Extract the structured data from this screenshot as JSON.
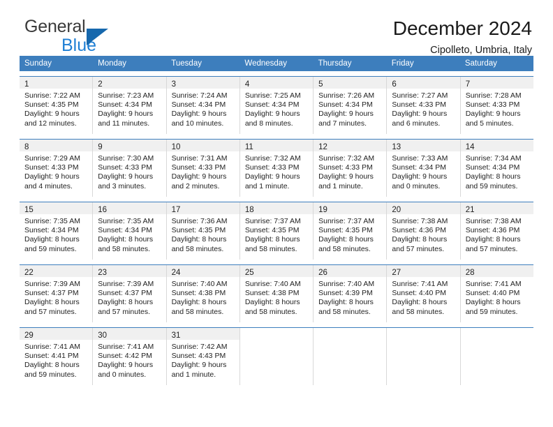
{
  "brand": {
    "line1": "General",
    "line2": "Blue",
    "triangle_color": "#1668ad",
    "blue_color": "#1f7fd4"
  },
  "header": {
    "title": "December 2024",
    "location": "Cipolleto, Umbria, Italy"
  },
  "theme": {
    "header_blue": "#3d7ebd",
    "daynum_band": "#f0f0f0",
    "grid_line": "#d8d8d8"
  },
  "weekdays": [
    "Sunday",
    "Monday",
    "Tuesday",
    "Wednesday",
    "Thursday",
    "Friday",
    "Saturday"
  ],
  "weeks": [
    [
      {
        "day": "1",
        "sunrise": "Sunrise: 7:22 AM",
        "sunset": "Sunset: 4:35 PM",
        "daylight1": "Daylight: 9 hours",
        "daylight2": "and 12 minutes."
      },
      {
        "day": "2",
        "sunrise": "Sunrise: 7:23 AM",
        "sunset": "Sunset: 4:34 PM",
        "daylight1": "Daylight: 9 hours",
        "daylight2": "and 11 minutes."
      },
      {
        "day": "3",
        "sunrise": "Sunrise: 7:24 AM",
        "sunset": "Sunset: 4:34 PM",
        "daylight1": "Daylight: 9 hours",
        "daylight2": "and 10 minutes."
      },
      {
        "day": "4",
        "sunrise": "Sunrise: 7:25 AM",
        "sunset": "Sunset: 4:34 PM",
        "daylight1": "Daylight: 9 hours",
        "daylight2": "and 8 minutes."
      },
      {
        "day": "5",
        "sunrise": "Sunrise: 7:26 AM",
        "sunset": "Sunset: 4:34 PM",
        "daylight1": "Daylight: 9 hours",
        "daylight2": "and 7 minutes."
      },
      {
        "day": "6",
        "sunrise": "Sunrise: 7:27 AM",
        "sunset": "Sunset: 4:33 PM",
        "daylight1": "Daylight: 9 hours",
        "daylight2": "and 6 minutes."
      },
      {
        "day": "7",
        "sunrise": "Sunrise: 7:28 AM",
        "sunset": "Sunset: 4:33 PM",
        "daylight1": "Daylight: 9 hours",
        "daylight2": "and 5 minutes."
      }
    ],
    [
      {
        "day": "8",
        "sunrise": "Sunrise: 7:29 AM",
        "sunset": "Sunset: 4:33 PM",
        "daylight1": "Daylight: 9 hours",
        "daylight2": "and 4 minutes."
      },
      {
        "day": "9",
        "sunrise": "Sunrise: 7:30 AM",
        "sunset": "Sunset: 4:33 PM",
        "daylight1": "Daylight: 9 hours",
        "daylight2": "and 3 minutes."
      },
      {
        "day": "10",
        "sunrise": "Sunrise: 7:31 AM",
        "sunset": "Sunset: 4:33 PM",
        "daylight1": "Daylight: 9 hours",
        "daylight2": "and 2 minutes."
      },
      {
        "day": "11",
        "sunrise": "Sunrise: 7:32 AM",
        "sunset": "Sunset: 4:33 PM",
        "daylight1": "Daylight: 9 hours",
        "daylight2": "and 1 minute."
      },
      {
        "day": "12",
        "sunrise": "Sunrise: 7:32 AM",
        "sunset": "Sunset: 4:33 PM",
        "daylight1": "Daylight: 9 hours",
        "daylight2": "and 1 minute."
      },
      {
        "day": "13",
        "sunrise": "Sunrise: 7:33 AM",
        "sunset": "Sunset: 4:34 PM",
        "daylight1": "Daylight: 9 hours",
        "daylight2": "and 0 minutes."
      },
      {
        "day": "14",
        "sunrise": "Sunrise: 7:34 AM",
        "sunset": "Sunset: 4:34 PM",
        "daylight1": "Daylight: 8 hours",
        "daylight2": "and 59 minutes."
      }
    ],
    [
      {
        "day": "15",
        "sunrise": "Sunrise: 7:35 AM",
        "sunset": "Sunset: 4:34 PM",
        "daylight1": "Daylight: 8 hours",
        "daylight2": "and 59 minutes."
      },
      {
        "day": "16",
        "sunrise": "Sunrise: 7:35 AM",
        "sunset": "Sunset: 4:34 PM",
        "daylight1": "Daylight: 8 hours",
        "daylight2": "and 58 minutes."
      },
      {
        "day": "17",
        "sunrise": "Sunrise: 7:36 AM",
        "sunset": "Sunset: 4:35 PM",
        "daylight1": "Daylight: 8 hours",
        "daylight2": "and 58 minutes."
      },
      {
        "day": "18",
        "sunrise": "Sunrise: 7:37 AM",
        "sunset": "Sunset: 4:35 PM",
        "daylight1": "Daylight: 8 hours",
        "daylight2": "and 58 minutes."
      },
      {
        "day": "19",
        "sunrise": "Sunrise: 7:37 AM",
        "sunset": "Sunset: 4:35 PM",
        "daylight1": "Daylight: 8 hours",
        "daylight2": "and 58 minutes."
      },
      {
        "day": "20",
        "sunrise": "Sunrise: 7:38 AM",
        "sunset": "Sunset: 4:36 PM",
        "daylight1": "Daylight: 8 hours",
        "daylight2": "and 57 minutes."
      },
      {
        "day": "21",
        "sunrise": "Sunrise: 7:38 AM",
        "sunset": "Sunset: 4:36 PM",
        "daylight1": "Daylight: 8 hours",
        "daylight2": "and 57 minutes."
      }
    ],
    [
      {
        "day": "22",
        "sunrise": "Sunrise: 7:39 AM",
        "sunset": "Sunset: 4:37 PM",
        "daylight1": "Daylight: 8 hours",
        "daylight2": "and 57 minutes."
      },
      {
        "day": "23",
        "sunrise": "Sunrise: 7:39 AM",
        "sunset": "Sunset: 4:37 PM",
        "daylight1": "Daylight: 8 hours",
        "daylight2": "and 57 minutes."
      },
      {
        "day": "24",
        "sunrise": "Sunrise: 7:40 AM",
        "sunset": "Sunset: 4:38 PM",
        "daylight1": "Daylight: 8 hours",
        "daylight2": "and 58 minutes."
      },
      {
        "day": "25",
        "sunrise": "Sunrise: 7:40 AM",
        "sunset": "Sunset: 4:38 PM",
        "daylight1": "Daylight: 8 hours",
        "daylight2": "and 58 minutes."
      },
      {
        "day": "26",
        "sunrise": "Sunrise: 7:40 AM",
        "sunset": "Sunset: 4:39 PM",
        "daylight1": "Daylight: 8 hours",
        "daylight2": "and 58 minutes."
      },
      {
        "day": "27",
        "sunrise": "Sunrise: 7:41 AM",
        "sunset": "Sunset: 4:40 PM",
        "daylight1": "Daylight: 8 hours",
        "daylight2": "and 58 minutes."
      },
      {
        "day": "28",
        "sunrise": "Sunrise: 7:41 AM",
        "sunset": "Sunset: 4:40 PM",
        "daylight1": "Daylight: 8 hours",
        "daylight2": "and 59 minutes."
      }
    ],
    [
      {
        "day": "29",
        "sunrise": "Sunrise: 7:41 AM",
        "sunset": "Sunset: 4:41 PM",
        "daylight1": "Daylight: 8 hours",
        "daylight2": "and 59 minutes."
      },
      {
        "day": "30",
        "sunrise": "Sunrise: 7:41 AM",
        "sunset": "Sunset: 4:42 PM",
        "daylight1": "Daylight: 9 hours",
        "daylight2": "and 0 minutes."
      },
      {
        "day": "31",
        "sunrise": "Sunrise: 7:42 AM",
        "sunset": "Sunset: 4:43 PM",
        "daylight1": "Daylight: 9 hours",
        "daylight2": "and 1 minute."
      },
      {
        "day": "",
        "sunrise": "",
        "sunset": "",
        "daylight1": "",
        "daylight2": ""
      },
      {
        "day": "",
        "sunrise": "",
        "sunset": "",
        "daylight1": "",
        "daylight2": ""
      },
      {
        "day": "",
        "sunrise": "",
        "sunset": "",
        "daylight1": "",
        "daylight2": ""
      },
      {
        "day": "",
        "sunrise": "",
        "sunset": "",
        "daylight1": "",
        "daylight2": ""
      }
    ]
  ]
}
